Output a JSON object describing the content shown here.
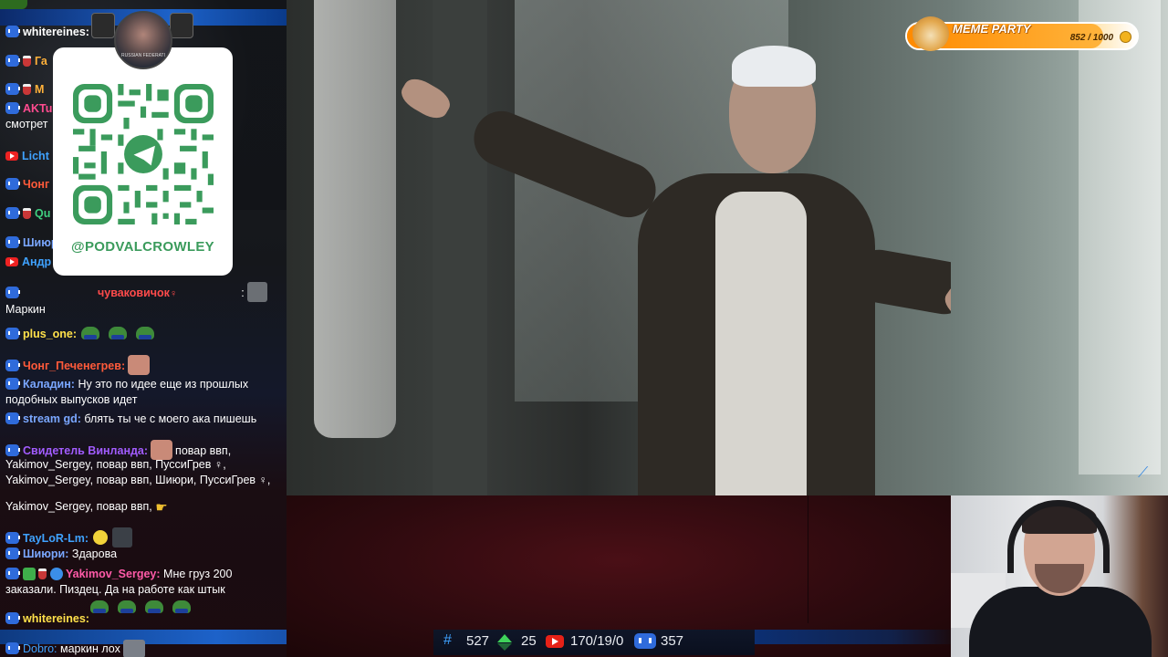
{
  "meme_party": {
    "title": "MEME PARTY",
    "count": "852 / 1000",
    "progress": 0.852
  },
  "qr": {
    "handle": "@PODVALCROWLEY",
    "avatar_caption": "RUSSIAN FEDERATI"
  },
  "chat": [
    {
      "nick": "whitereines:",
      "text": "",
      "nick_color": "#ffffff"
    },
    {
      "nick": "Га",
      "text": "",
      "nick_color": "#ffb13a"
    },
    {
      "nick": "М",
      "text": "",
      "nick_color": "#ffb13a"
    },
    {
      "nick": "AKTu",
      "text": "смотрет",
      "nick_color": "#ff4b8f"
    },
    {
      "nick": "Licht",
      "text": "",
      "nick_color": "#3fa2ff"
    },
    {
      "nick": "Чонг",
      "text": "",
      "nick_color": "#ff5a3a"
    },
    {
      "nick": "Qu",
      "text": "",
      "nick_color": "#3fcf7f"
    },
    {
      "nick": "Шиюр",
      "text": "",
      "nick_color": "#7aa7ff"
    },
    {
      "nick": "Андр",
      "text": "",
      "nick_color": "#3fa2ff"
    },
    {
      "nick": "чуваковичок",
      "text": "Маркин",
      "nick_color": "#ff4b4b"
    },
    {
      "nick": "plus_one:",
      "text": "",
      "nick_color": "#ffe14a"
    },
    {
      "nick": "Чонг_Печенегрев:",
      "text": "",
      "nick_color": "#ff5a3a"
    },
    {
      "nick": "Каладин:",
      "text": "Ну это по идее еще из прошлых подобных выпусков идет",
      "nick_color": "#7aa7ff"
    },
    {
      "nick": "stream gd:",
      "text": "блять ты че с моего ака пишешь",
      "nick_color": "#7aa7ff"
    },
    {
      "nick": "Свидетель Винланда:",
      "text": "повар ввп,",
      "nick_color": "#a25cff"
    },
    {
      "nick": "",
      "text": "Yakimov_Sergey, повар ввп, ПуссиГрев ♀,",
      "nick_color": "#ffffff"
    },
    {
      "nick": "",
      "text": "Yakimov_Sergey, повар ввп, Шиюри, ПуссиГрев ♀,",
      "nick_color": "#ffffff"
    },
    {
      "nick": "",
      "text": "Yakimov_Sergey, повар ввп,",
      "nick_color": "#ffffff"
    },
    {
      "nick": "TayLoR-Lm:",
      "text": "",
      "nick_color": "#3fa2ff"
    },
    {
      "nick": "Шиюри:",
      "text": "Здарова",
      "nick_color": "#7aa7ff"
    },
    {
      "nick": "Yakimov_Sergey:",
      "text": "Мне груз 200 заказали. Пиздец. Да на работе как штык",
      "nick_color": "#ff5aa8"
    },
    {
      "nick": "whitereines:",
      "text": "",
      "nick_color": "#ffe14a"
    },
    {
      "nick": "Dobro:",
      "text": "маркин лох",
      "nick_color": "#3fa2ff"
    }
  ],
  "stats": {
    "hash_count": "527",
    "up_count": "25",
    "yt_stats": "170/19/0",
    "vk_count": "357"
  }
}
